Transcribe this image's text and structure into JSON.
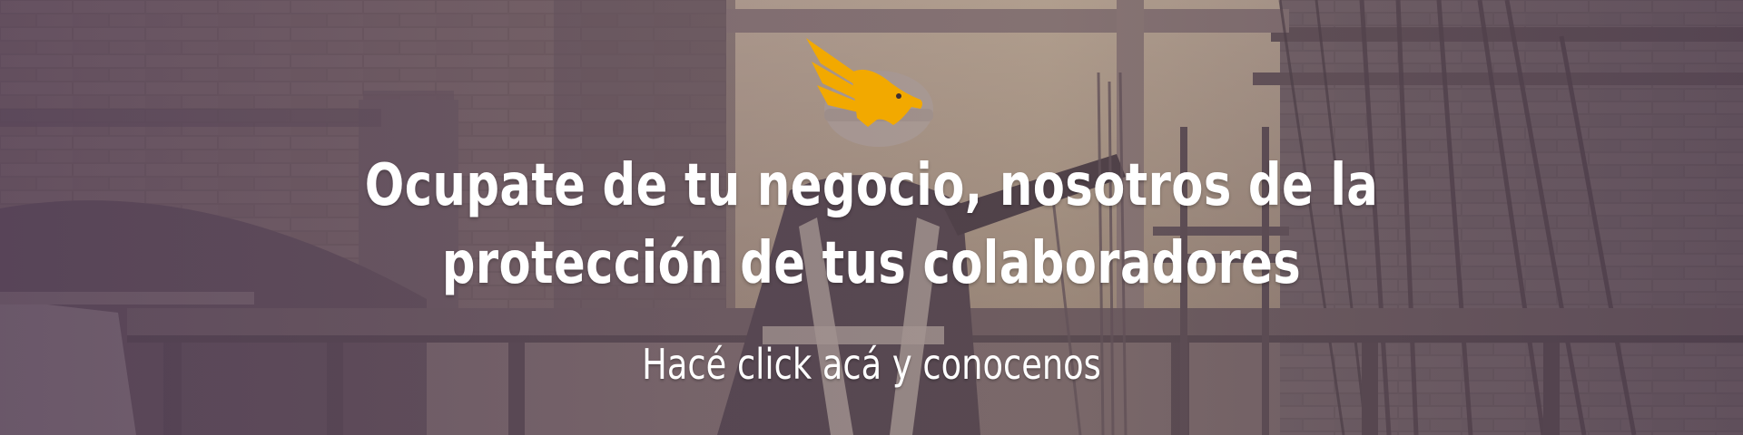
{
  "banner": {
    "headline": "Ocupate de  tu negocio, nosotros de la protección de tus colaboradores",
    "cta_label": "Hacé click acá y conocenos"
  },
  "icons": {
    "logo": "eagle-logo-icon"
  },
  "colors": {
    "accent": "#f2a900",
    "text": "#ffffff",
    "overlay": "#5a4658"
  }
}
